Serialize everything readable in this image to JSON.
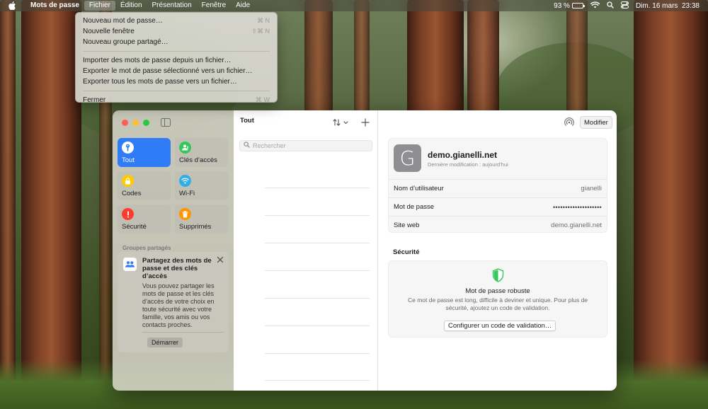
{
  "menubar": {
    "app_name": "Mots de passe",
    "menus": [
      "Fichier",
      "Édition",
      "Présentation",
      "Fenêtre",
      "Aide"
    ],
    "battery": "93 %",
    "battery_level": 0.93,
    "datetime": "Dim. 16 mars  23:38"
  },
  "file_menu": {
    "items": [
      {
        "label": "Nouveau mot de passe…",
        "shortcut": "⌘ N"
      },
      {
        "label": "Nouvelle fenêtre",
        "shortcut": "⇧⌘ N"
      },
      {
        "label": "Nouveau groupe partagé…",
        "shortcut": ""
      },
      {
        "label": "Importer des mots de passe depuis un fichier…",
        "shortcut": ""
      },
      {
        "label": "Exporter le mot de passe sélectionné vers un fichier…",
        "shortcut": ""
      },
      {
        "label": "Exporter tous les mots de passe vers un fichier…",
        "shortcut": ""
      },
      {
        "label": "Fermer",
        "shortcut": "⌘ W"
      }
    ]
  },
  "sidebar": {
    "categories": [
      {
        "label": "Tout",
        "icon": "key-icon",
        "color": "#2f7cf6"
      },
      {
        "label": "Clés d’accès",
        "icon": "person-icon",
        "color": "#34c759"
      },
      {
        "label": "Codes",
        "icon": "lock-code-icon",
        "color": "#ffcc00"
      },
      {
        "label": "Wi-Fi",
        "icon": "wifi-icon",
        "color": "#32ade6"
      },
      {
        "label": "Sécurité",
        "icon": "alert-icon",
        "color": "#ff3b30"
      },
      {
        "label": "Supprimés",
        "icon": "trash-icon",
        "color": "#ff9500"
      }
    ],
    "groups_title": "Groupes partagés",
    "share_card": {
      "title": "Partagez des mots de passe et des clés d’accès",
      "body": "Vous pouvez partager les mots de passe et les clés d’accès de votre choix en toute sécurité avec votre famille, vos amis ou vos contacts proches.",
      "button": "Démarrer"
    }
  },
  "list": {
    "title": "Tout",
    "search_placeholder": "Rechercher"
  },
  "detail": {
    "edit_button": "Modifier",
    "avatar_letter": "G",
    "site": "demo.gianelli.net",
    "modified": "Dernière modification : aujourd’hui",
    "fields": [
      {
        "label": "Nom d’utilisateur",
        "value": "gianelli"
      },
      {
        "label": "Mot de passe",
        "value": "••••••••••••••••••••"
      },
      {
        "label": "Site web",
        "value": "demo.gianelli.net"
      }
    ],
    "security_title": "Sécurité",
    "security_strong": "Mot de passe robuste",
    "security_desc": "Ce mot de passe est long, difficile à deviner et unique. Pour plus de sécurité, ajoutez un code de validation.",
    "security_button": "Configurer un code de validation…"
  },
  "colors": {
    "accent": "#2f7cf6",
    "shield": "#34c759",
    "traffic_close": "#ff5f57",
    "traffic_min": "#febc2e",
    "traffic_max": "#28c840"
  }
}
